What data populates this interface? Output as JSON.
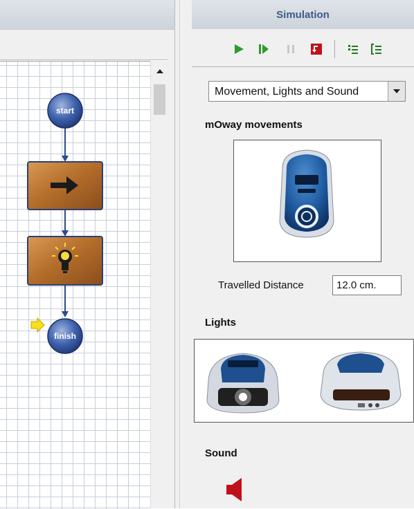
{
  "simulation": {
    "title": "Simulation",
    "toolbar": {
      "play_icon": "play-icon",
      "step_icon": "step-forward-icon",
      "pause_icon": "pause-icon",
      "stop_icon": "stop-icon",
      "step_into_icon": "step-into-icon",
      "step_out_icon": "step-out-icon",
      "colors": {
        "green": "#2e9a2e",
        "red": "#c0111b",
        "gray": "#c8c8c8",
        "dark_green": "#1f7a1f"
      }
    },
    "mode": {
      "selected": "Movement, Lights and Sound"
    },
    "movements": {
      "label": "mOway movements",
      "distance_label": "Travelled Distance",
      "distance_value": "12.0 cm."
    },
    "lights": {
      "label": "Lights"
    },
    "sound": {
      "label": "Sound",
      "icon": "speaker-icon",
      "color": "#c0111b"
    }
  },
  "flowchart": {
    "start_label": "start",
    "finish_label": "finish",
    "blocks": [
      {
        "icon": "arrow-right-icon"
      },
      {
        "icon": "lightbulb-icon"
      }
    ],
    "current_marker_icon": "current-step-arrow-icon",
    "colors": {
      "node": "#3a5fa8",
      "block": "#b56f2c",
      "marker": "#f7e019"
    }
  }
}
